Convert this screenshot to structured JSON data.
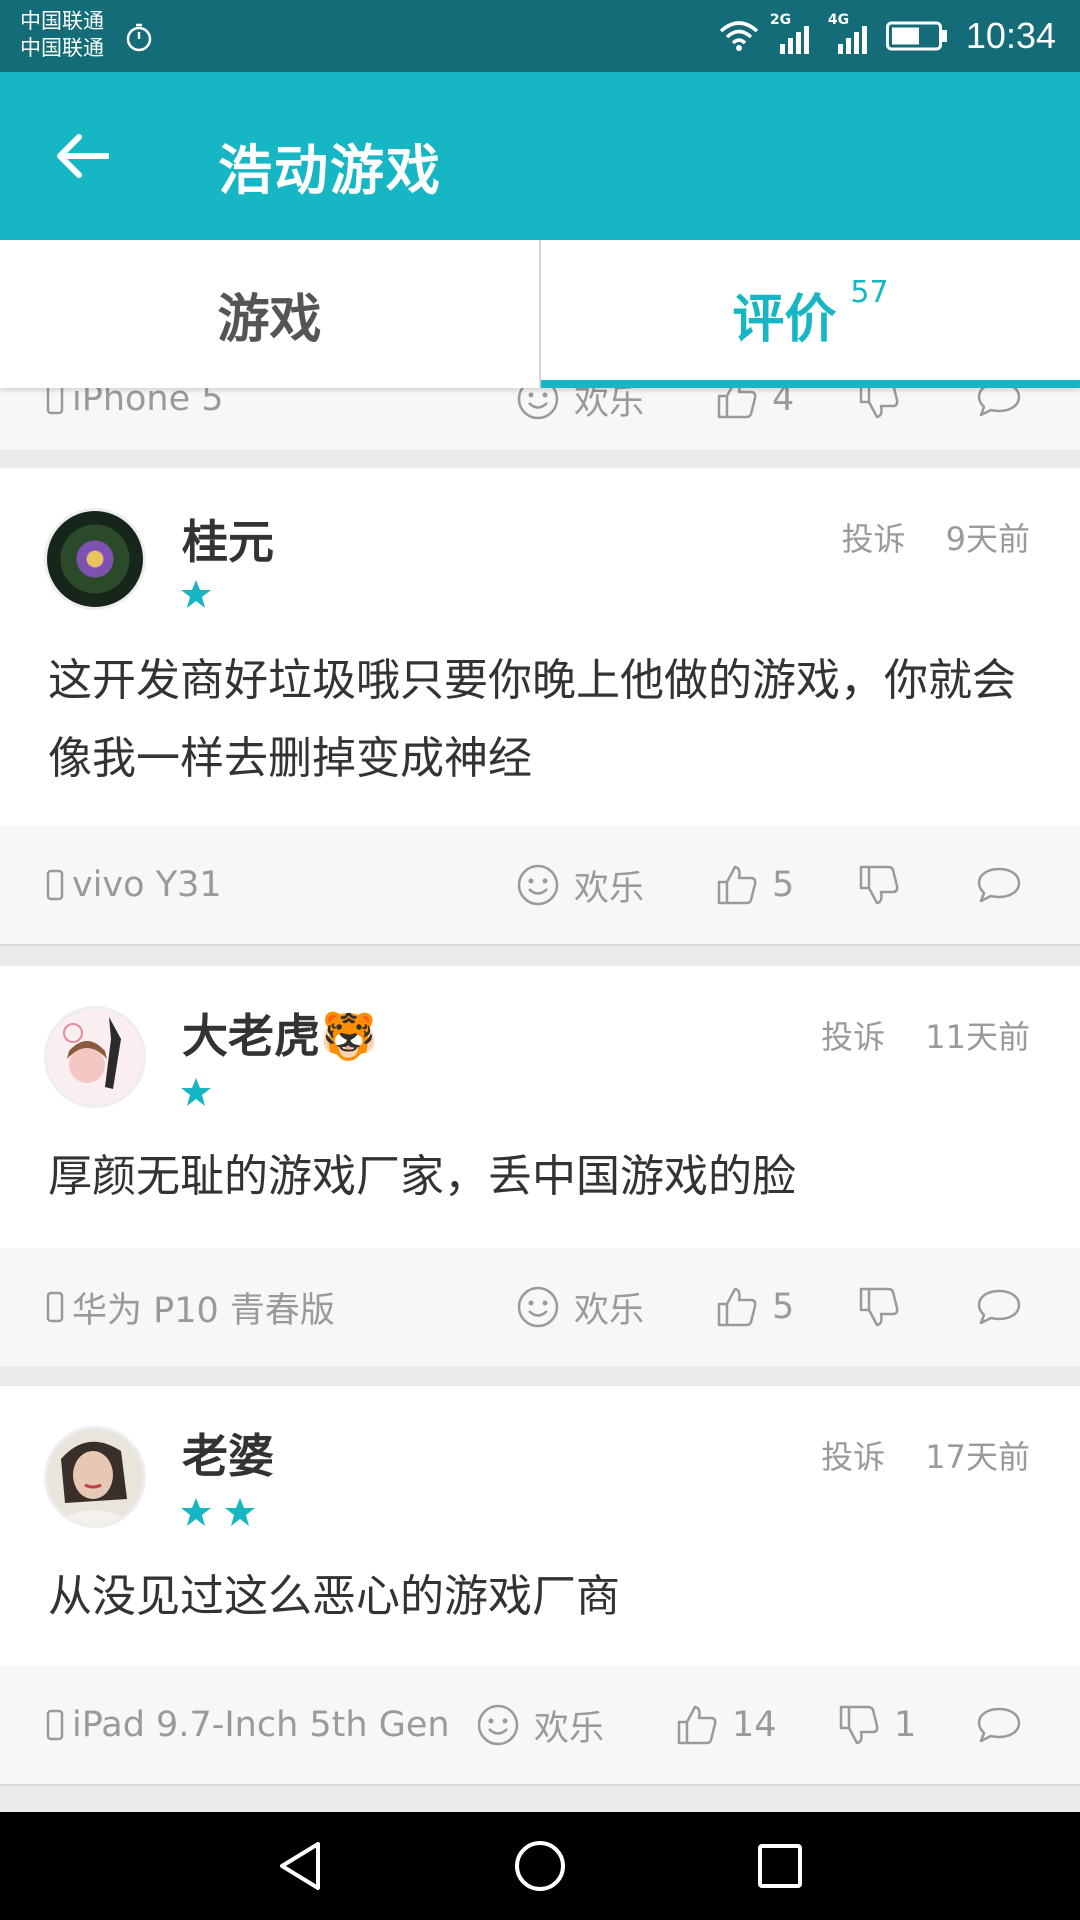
{
  "status_bar": {
    "carrier_1": "中国联通",
    "carrier_2": "中国联通",
    "network_1": "2G",
    "network_2": "4G",
    "time": "10:34",
    "battery_level": 0.6
  },
  "app_bar": {
    "title": "浩动游戏"
  },
  "tabs": [
    {
      "label": "游戏",
      "badge": "",
      "selected": false
    },
    {
      "label": "评价",
      "badge": "57",
      "selected": true
    }
  ],
  "partial_review": {
    "device": "iPhone 5",
    "mood": "欢乐",
    "likes": "4",
    "dislikes": ""
  },
  "reviews": [
    {
      "name": "桂元",
      "name_emoji": "",
      "report_label": "投诉",
      "time": "9天前",
      "rating": 1,
      "content": "这开发商好垃圾哦只要你晚上他做的游戏，你就会像我一样去删掉变成神经",
      "device": "vivo Y31",
      "mood": "欢乐",
      "likes": "5",
      "dislikes": "",
      "avatar": "purple-flower-avatar"
    },
    {
      "name": "大老虎",
      "name_emoji": "🐯",
      "report_label": "投诉",
      "time": "11天前",
      "rating": 1,
      "content": "厚颜无耻的游戏厂家，丢中国游戏的脸",
      "device": "华为 P10 青春版",
      "mood": "欢乐",
      "likes": "5",
      "dislikes": "",
      "avatar": "anime-girl-avatar"
    },
    {
      "name": "老婆",
      "name_emoji": "",
      "report_label": "投诉",
      "time": "17天前",
      "rating": 2,
      "content": "从没见过这么恶心的游戏厂商",
      "device": "iPad 9.7-Inch 5th Gen",
      "mood": "欢乐",
      "likes": "14",
      "dislikes": "1",
      "avatar": "woman-photo-avatar"
    }
  ],
  "colors": {
    "accent": "#17b6c4",
    "status_bar": "#136c78",
    "text_primary": "#333333",
    "text_secondary": "#9a9a9a"
  }
}
